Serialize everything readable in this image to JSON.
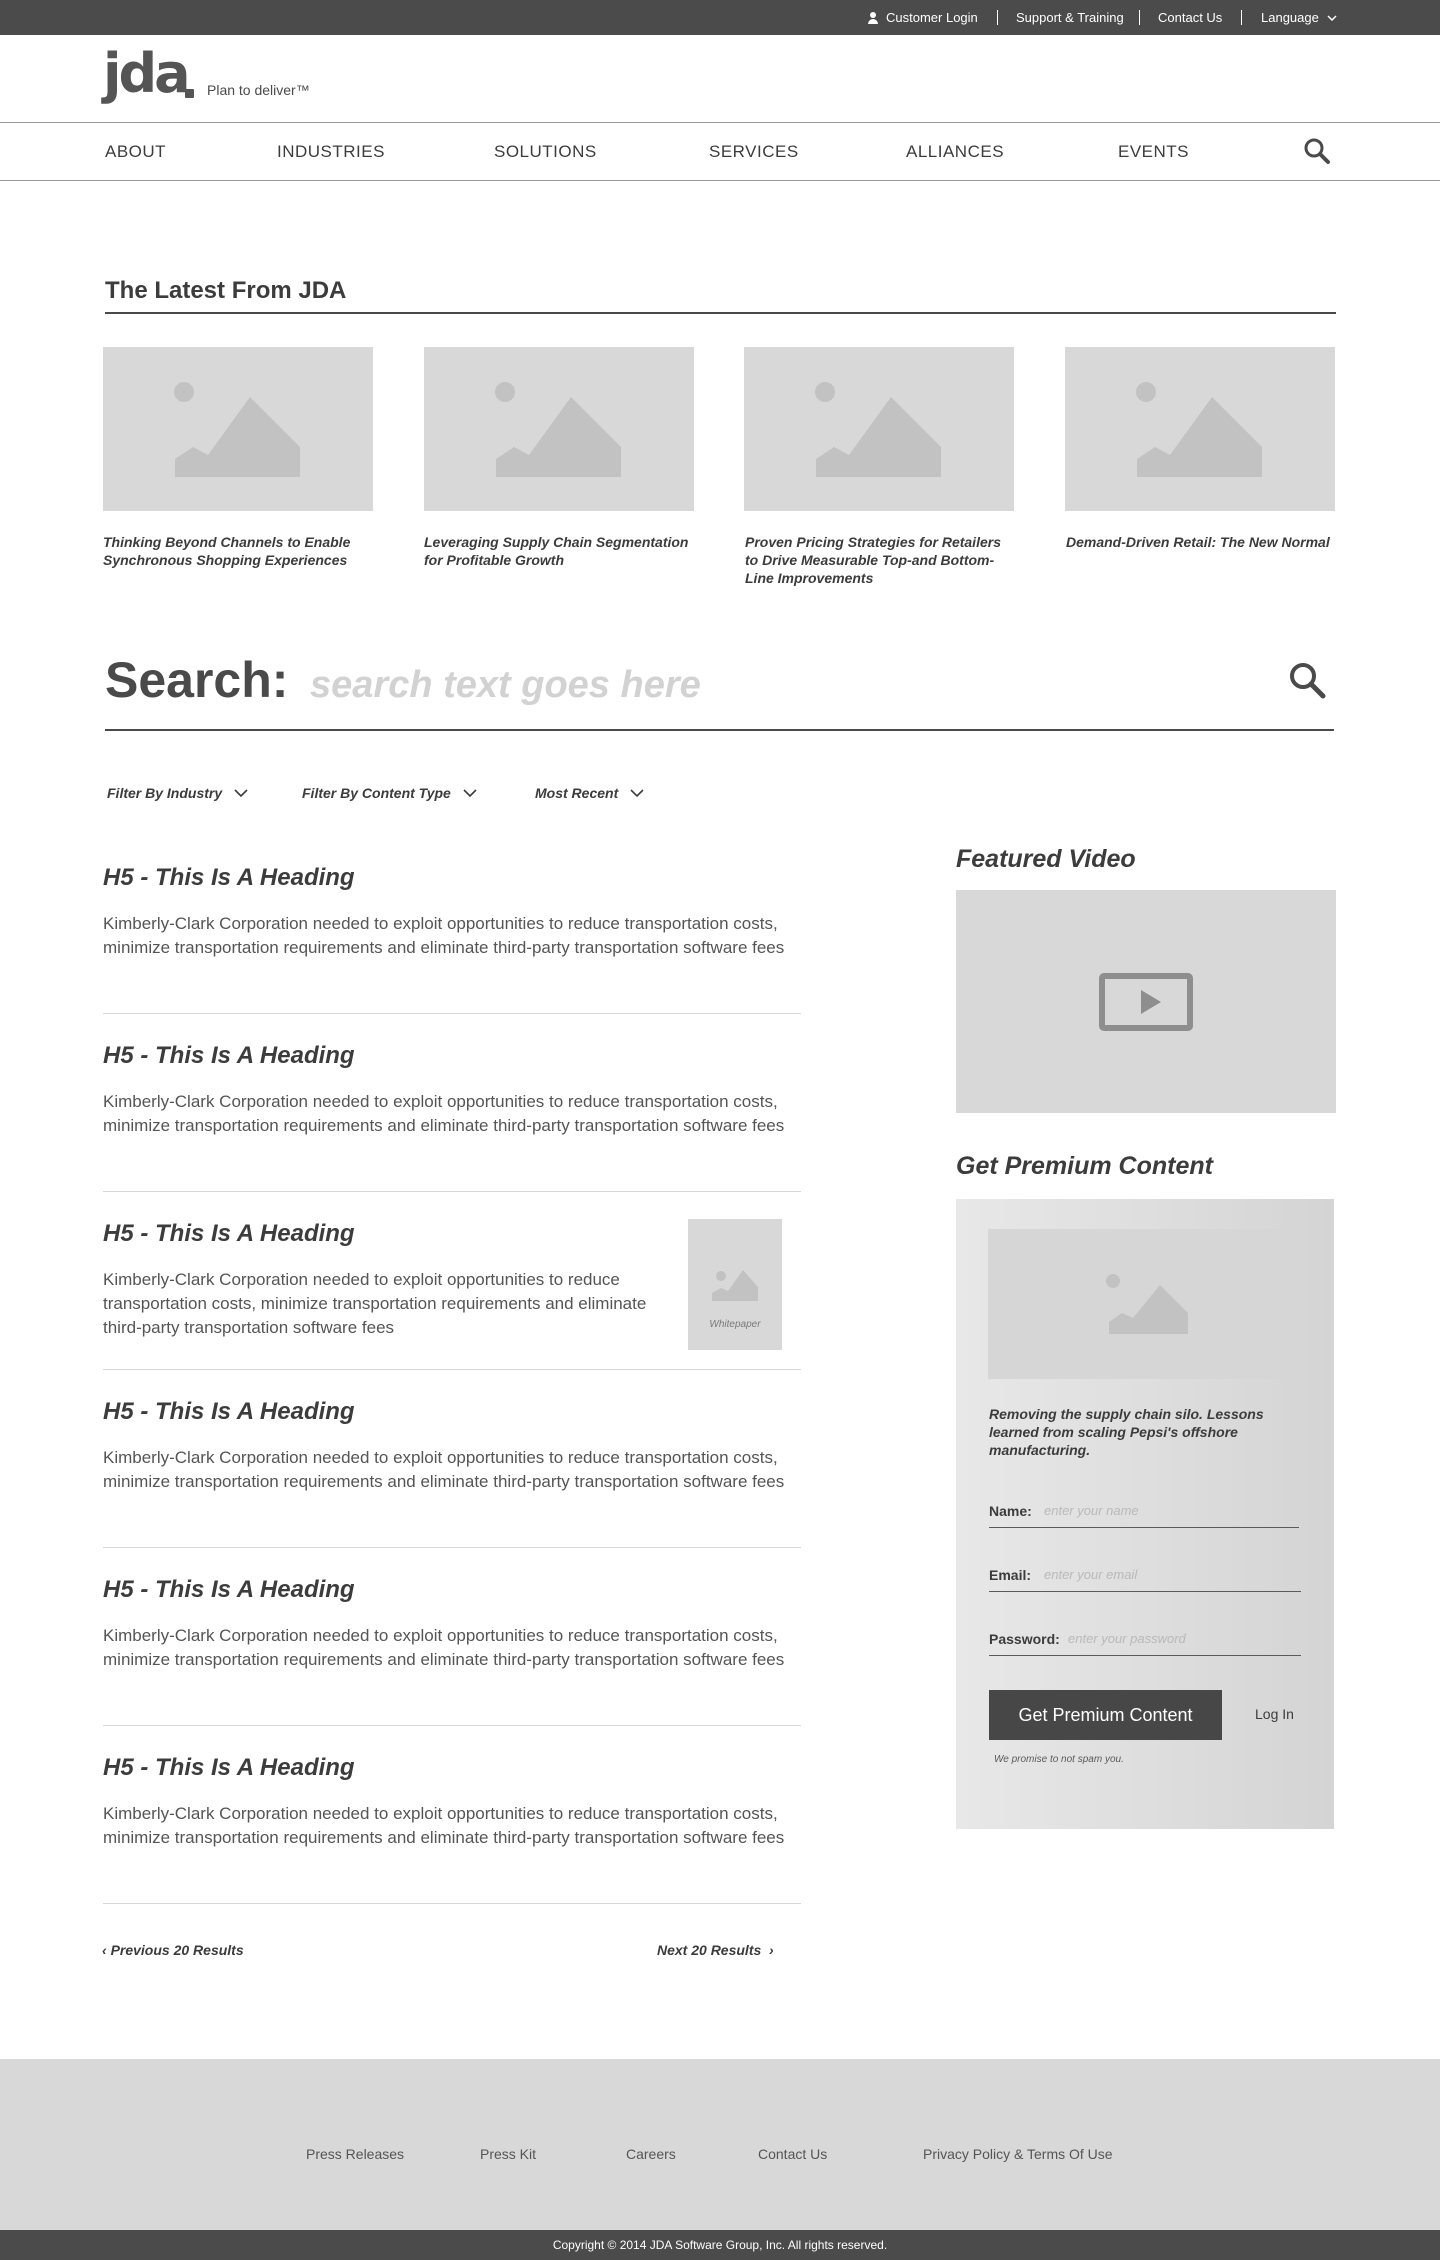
{
  "topbar": {
    "customer_login": "Customer Login",
    "support": "Support & Training",
    "contact": "Contact Us",
    "language": "Language"
  },
  "logo": {
    "word": "jda",
    "tagline": "Plan to deliver™"
  },
  "nav": {
    "items": [
      "ABOUT",
      "INDUSTRIES",
      "SOLUTIONS",
      "SERVICES",
      "ALLIANCES",
      "EVENTS"
    ]
  },
  "latest": {
    "title": "The Latest From JDA",
    "cards": [
      {
        "caption": "Thinking Beyond Channels to Enable Synchronous Shopping Experiences"
      },
      {
        "caption": "Leveraging Supply Chain Segmentation for Profitable Growth"
      },
      {
        "caption": "Proven Pricing Strategies for Retailers to Drive Measurable Top-and Bottom-Line Improvements"
      },
      {
        "caption": "Demand-Driven Retail: The New Normal"
      }
    ]
  },
  "search": {
    "label": "Search:",
    "placeholder": "search text goes here"
  },
  "filters": [
    "Filter By Industry",
    "Filter By Content Type",
    "Most Recent"
  ],
  "results": [
    {
      "heading": "H5 - This Is A Heading",
      "body": "Kimberly-Clark Corporation needed to exploit opportunities to reduce transportation costs, minimize transportation requirements and eliminate third-party transportation software fees"
    },
    {
      "heading": "H5 - This Is A Heading",
      "body": "Kimberly-Clark Corporation needed to exploit opportunities to reduce transportation costs, minimize transportation requirements and eliminate third-party transportation software fees"
    },
    {
      "heading": "H5 - This Is A Heading",
      "body": "Kimberly-Clark Corporation needed to exploit opportunities to reduce transportation costs, minimize transportation requirements and eliminate third-party transportation software fees",
      "thumb_label": "Whitepaper"
    },
    {
      "heading": "H5 - This Is A Heading",
      "body": "Kimberly-Clark Corporation needed to exploit opportunities to reduce transportation costs, minimize transportation requirements and eliminate third-party transportation software fees"
    },
    {
      "heading": "H5 - This Is A Heading",
      "body": "Kimberly-Clark Corporation needed to exploit opportunities to reduce transportation costs, minimize transportation requirements and eliminate third-party transportation software fees"
    },
    {
      "heading": "H5 - This Is A Heading",
      "body": "Kimberly-Clark Corporation needed to exploit opportunities to reduce transportation costs, minimize transportation requirements and eliminate third-party transportation software fees"
    }
  ],
  "pager": {
    "prev": "Previous 20 Results",
    "next": "Next 20 Results"
  },
  "sidebar": {
    "video_title": "Featured Video",
    "premium_title": "Get Premium Content",
    "premium_desc": "Removing the supply chain silo. Lessons learned from scaling Pepsi's offshore manufacturing.",
    "name_label": "Name:",
    "name_placeholder": "enter your name",
    "email_label": "Email:",
    "email_placeholder": "enter your email",
    "password_label": "Password:",
    "password_placeholder": "enter your password",
    "button": "Get Premium Content",
    "login": "Log In",
    "nospam": "We promise to not spam you."
  },
  "footer": {
    "links": [
      "Press Releases",
      "Press Kit",
      "Careers",
      "Contact Us",
      "Privacy Policy & Terms Of Use"
    ],
    "copyright": "Copyright © 2014 JDA Software Group, Inc. All rights reserved."
  },
  "colors": {
    "dark_bar": "#4b4b4b",
    "placeholder_gray": "#d8d8d8",
    "text": "#4a4a4a"
  }
}
